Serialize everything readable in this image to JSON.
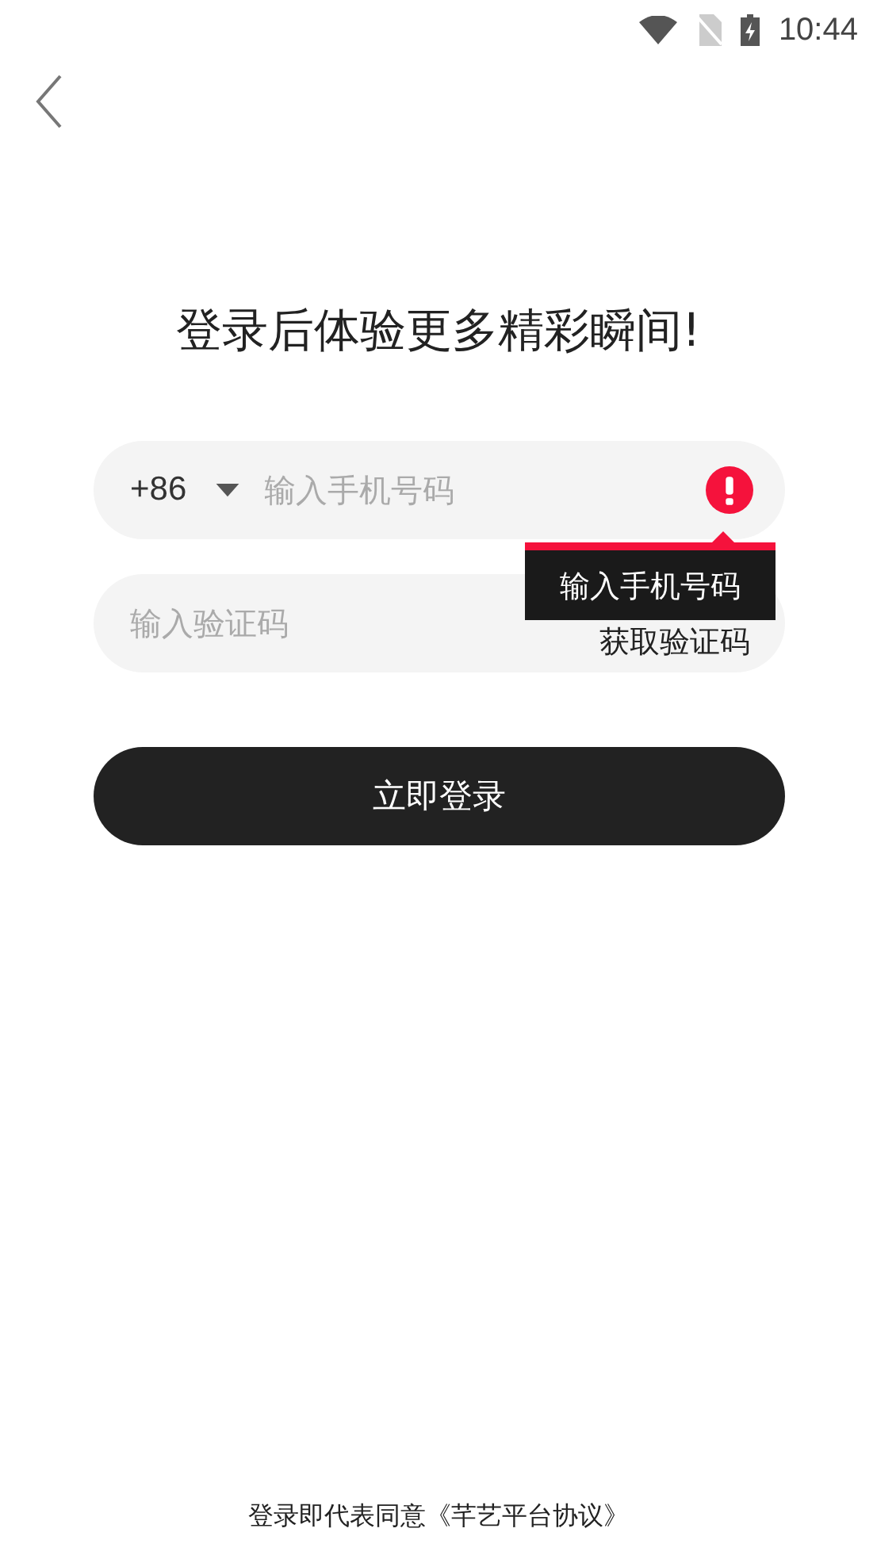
{
  "status_bar": {
    "time": "10:44"
  },
  "title": "登录后体验更多精彩瞬间!",
  "phone_field": {
    "country_code": "+86",
    "placeholder": "输入手机号码",
    "error": true,
    "error_message": "输入手机号码"
  },
  "code_field": {
    "placeholder": "输入验证码",
    "action": "获取验证码"
  },
  "login_button": "立即登录",
  "agreement": {
    "text": "登录即代表同意",
    "link": "《芊艺平台协议》"
  }
}
